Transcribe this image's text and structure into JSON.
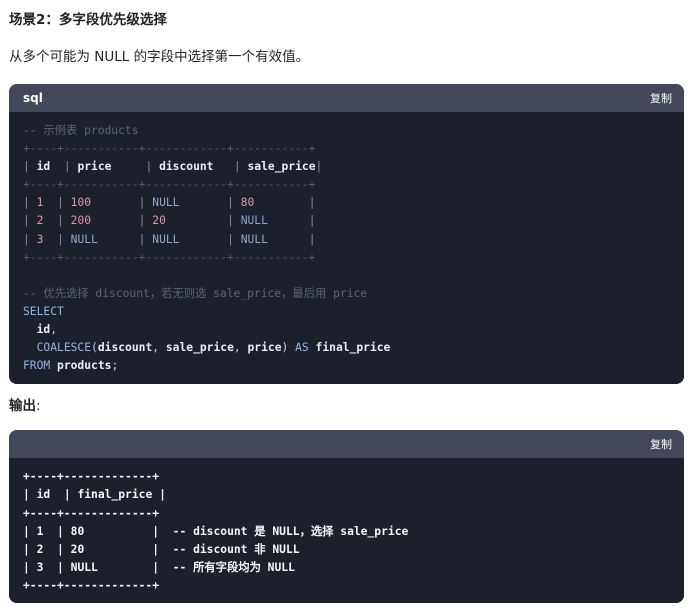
{
  "heading": "场景2：多字段优先级选择",
  "description": "从多个可能为 NULL 的字段中选择第一个有效值。",
  "block1": {
    "lang": "sql",
    "copy_label": "复制",
    "comment1": "-- 示例表 products",
    "table_border": "+----+-----------+------------+-----------+",
    "table_header": [
      "id",
      "price",
      "discount",
      "sale_price"
    ],
    "rows": [
      [
        "1",
        "100",
        "NULL",
        "80"
      ],
      [
        "2",
        "200",
        "20",
        "NULL"
      ],
      [
        "3",
        "NULL",
        "NULL",
        "NULL"
      ]
    ],
    "comment2": "-- 优先选择 discount，若无则选 sale_price，最后用 price",
    "kw_select": "SELECT",
    "col_id": "id",
    "fn_coalesce": "COALESCE",
    "arg1": "discount",
    "arg2": "sale_price",
    "arg3": "price",
    "kw_as": "AS",
    "alias": "final_price",
    "kw_from": "FROM",
    "table_name": "products"
  },
  "output_label": "输出",
  "block2": {
    "copy_label": "复制",
    "border": "+----+-------------+",
    "header": [
      "id",
      "final_price"
    ],
    "rows": [
      {
        "id": "1",
        "val": "80",
        "note": "-- discount 是 NULL，选择 sale_price"
      },
      {
        "id": "2",
        "val": "20",
        "note": "-- discount 非 NULL"
      },
      {
        "id": "3",
        "val": "NULL",
        "note": "-- 所有字段均为 NULL"
      }
    ]
  }
}
